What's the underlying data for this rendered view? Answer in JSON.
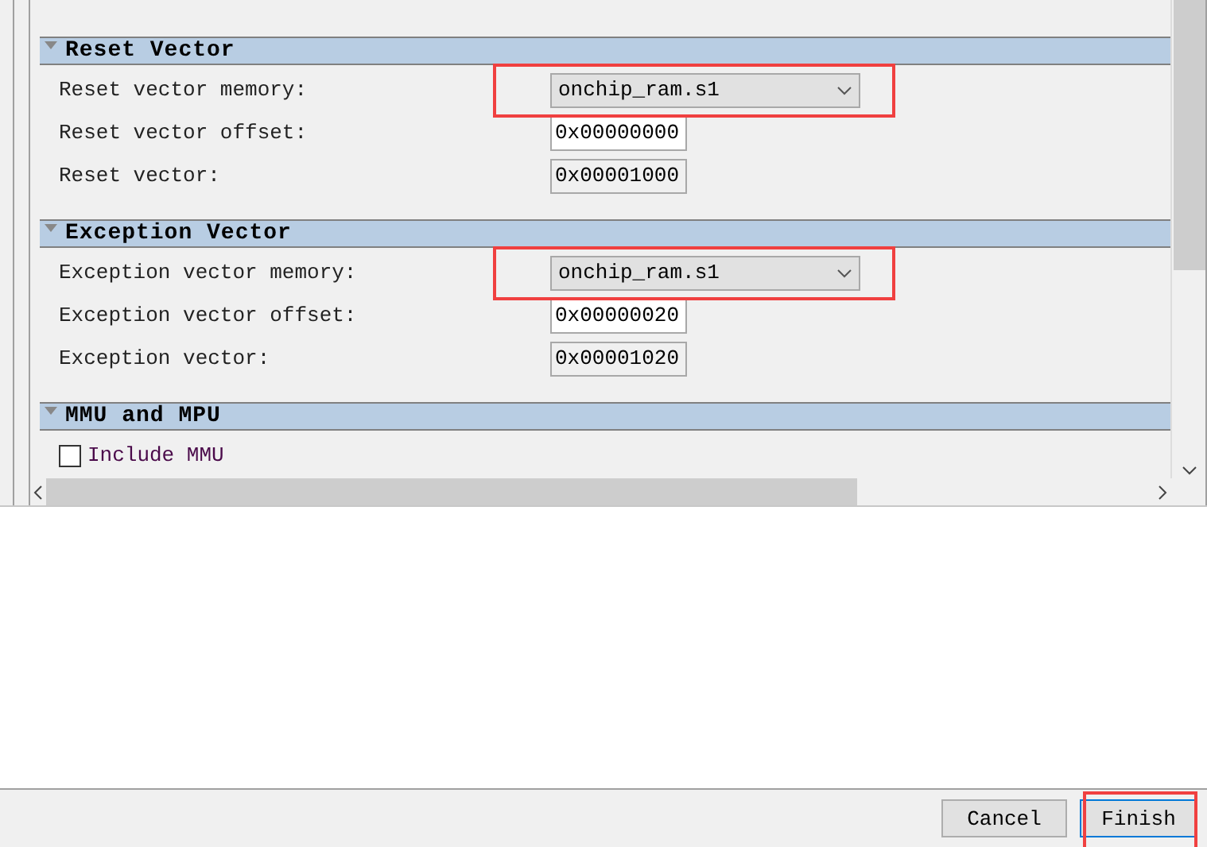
{
  "sections": [
    {
      "title": "Reset Vector",
      "rows": [
        {
          "kind": "dropdown",
          "label": "Reset vector memory:",
          "value": "onchip_ram.s1",
          "highlighted": true
        },
        {
          "kind": "text",
          "label": "Reset vector offset:",
          "value": "0x00000000",
          "disabled": false
        },
        {
          "kind": "text",
          "label": "Reset vector:",
          "value": "0x00001000",
          "disabled": true
        }
      ]
    },
    {
      "title": "Exception Vector",
      "rows": [
        {
          "kind": "dropdown",
          "label": "Exception vector memory:",
          "value": "onchip_ram.s1",
          "highlighted": true
        },
        {
          "kind": "text",
          "label": "Exception vector offset:",
          "value": "0x00000020",
          "disabled": false
        },
        {
          "kind": "text",
          "label": "Exception vector:",
          "value": "0x00001020",
          "disabled": true
        }
      ]
    },
    {
      "title": "MMU and MPU",
      "rows": [
        {
          "kind": "checkbox",
          "label": "Include MMU",
          "checked": false
        }
      ]
    }
  ],
  "buttons": [
    {
      "label": "Cancel",
      "highlighted": false
    },
    {
      "label": "Finish",
      "highlighted": true
    }
  ]
}
